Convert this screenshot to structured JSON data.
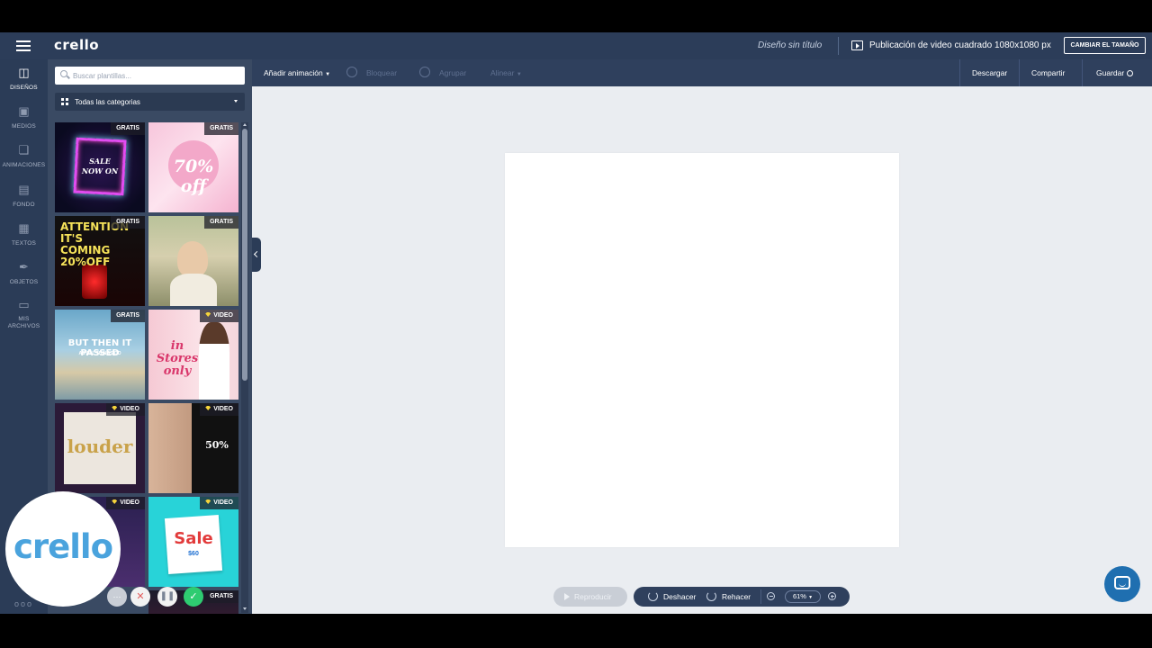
{
  "header": {
    "logo": "crello",
    "doc_title": "Diseño sin título",
    "format_title": "Publicación de video cuadrado 1080x1080 px",
    "resize_label": "CAMBIAR EL TAMAÑO"
  },
  "rail": {
    "items": [
      {
        "label": "DISEÑOS",
        "icon": "layout-icon"
      },
      {
        "label": "MEDIOS",
        "icon": "image-icon"
      },
      {
        "label": "ANIMACIONES",
        "icon": "animation-icon"
      },
      {
        "label": "FONDO",
        "icon": "background-icon"
      },
      {
        "label": "TEXTOS",
        "icon": "text-icon"
      },
      {
        "label": "OBJETOS",
        "icon": "objects-icon"
      },
      {
        "label": "MIS",
        "label2": "ARCHIVOS",
        "icon": "folder-icon"
      }
    ],
    "dots": "ooo"
  },
  "panel": {
    "search_placeholder": "Buscar plantillas...",
    "category": "Todas las categorias",
    "badges": {
      "free": "GRATIS",
      "video": "VIDEO"
    },
    "templates": [
      {
        "text": "SALE NOW ON",
        "badge": "GRATIS"
      },
      {
        "text": "70% off",
        "badge": "GRATIS"
      },
      {
        "text": "ATTENTION IT'S COMING 20%OFF",
        "badge": "GRATIS"
      },
      {
        "text": "",
        "badge": "GRATIS"
      },
      {
        "text": "BUT THEN IT PASSED",
        "sub": "AS ALL THINGS DO",
        "badge": "GRATIS"
      },
      {
        "text": "in Stores only",
        "badge": "VIDEO"
      },
      {
        "text": "louder",
        "badge": "VIDEO"
      },
      {
        "text": "50%",
        "badge": "VIDEO"
      },
      {
        "text": "",
        "badge": "VIDEO"
      },
      {
        "text": "Sale",
        "sub": "$60",
        "badge": "VIDEO"
      },
      {
        "text": "",
        "badge": "GRATIS"
      }
    ]
  },
  "toolbar": {
    "add_animation": "Añadir animación",
    "lock": "Bloquear",
    "group": "Agrupar",
    "align": "Alinear",
    "download": "Descargar",
    "share": "Compartir",
    "save": "Guardar"
  },
  "bottom": {
    "play": "Reproducir",
    "undo": "Deshacer",
    "redo": "Rehacer",
    "zoom": "61%"
  },
  "overlay": {
    "logo": "crello"
  },
  "colors": {
    "topbar": "#2c3d59",
    "panel": "#3a4a63",
    "canvas_bg": "#eaedf1",
    "accent": "#4aa3dd"
  }
}
